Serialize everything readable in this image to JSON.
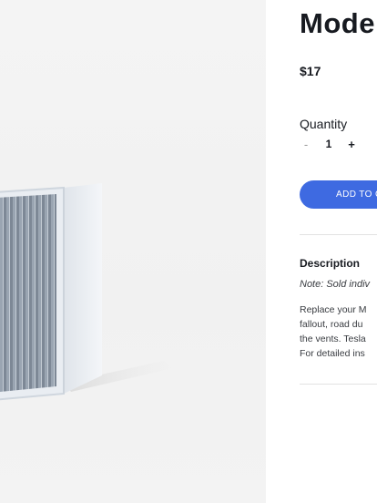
{
  "product": {
    "title": "Mode",
    "price": "$17",
    "image_icon": "cabin-air-filter-image"
  },
  "quantity": {
    "label": "Quantity",
    "decrement": "-",
    "value": "1",
    "increment": "+"
  },
  "cart": {
    "add_label": "ADD TO C"
  },
  "description": {
    "heading": "Description",
    "note": "Note: Sold indiv",
    "lines": [
      "Replace your M",
      "fallout, road du",
      "the vents. Tesla",
      "For detailed ins"
    ]
  },
  "colors": {
    "accent": "#3e6ae1",
    "text": "#171a20",
    "gallery_bg": "#f2f2f2"
  }
}
